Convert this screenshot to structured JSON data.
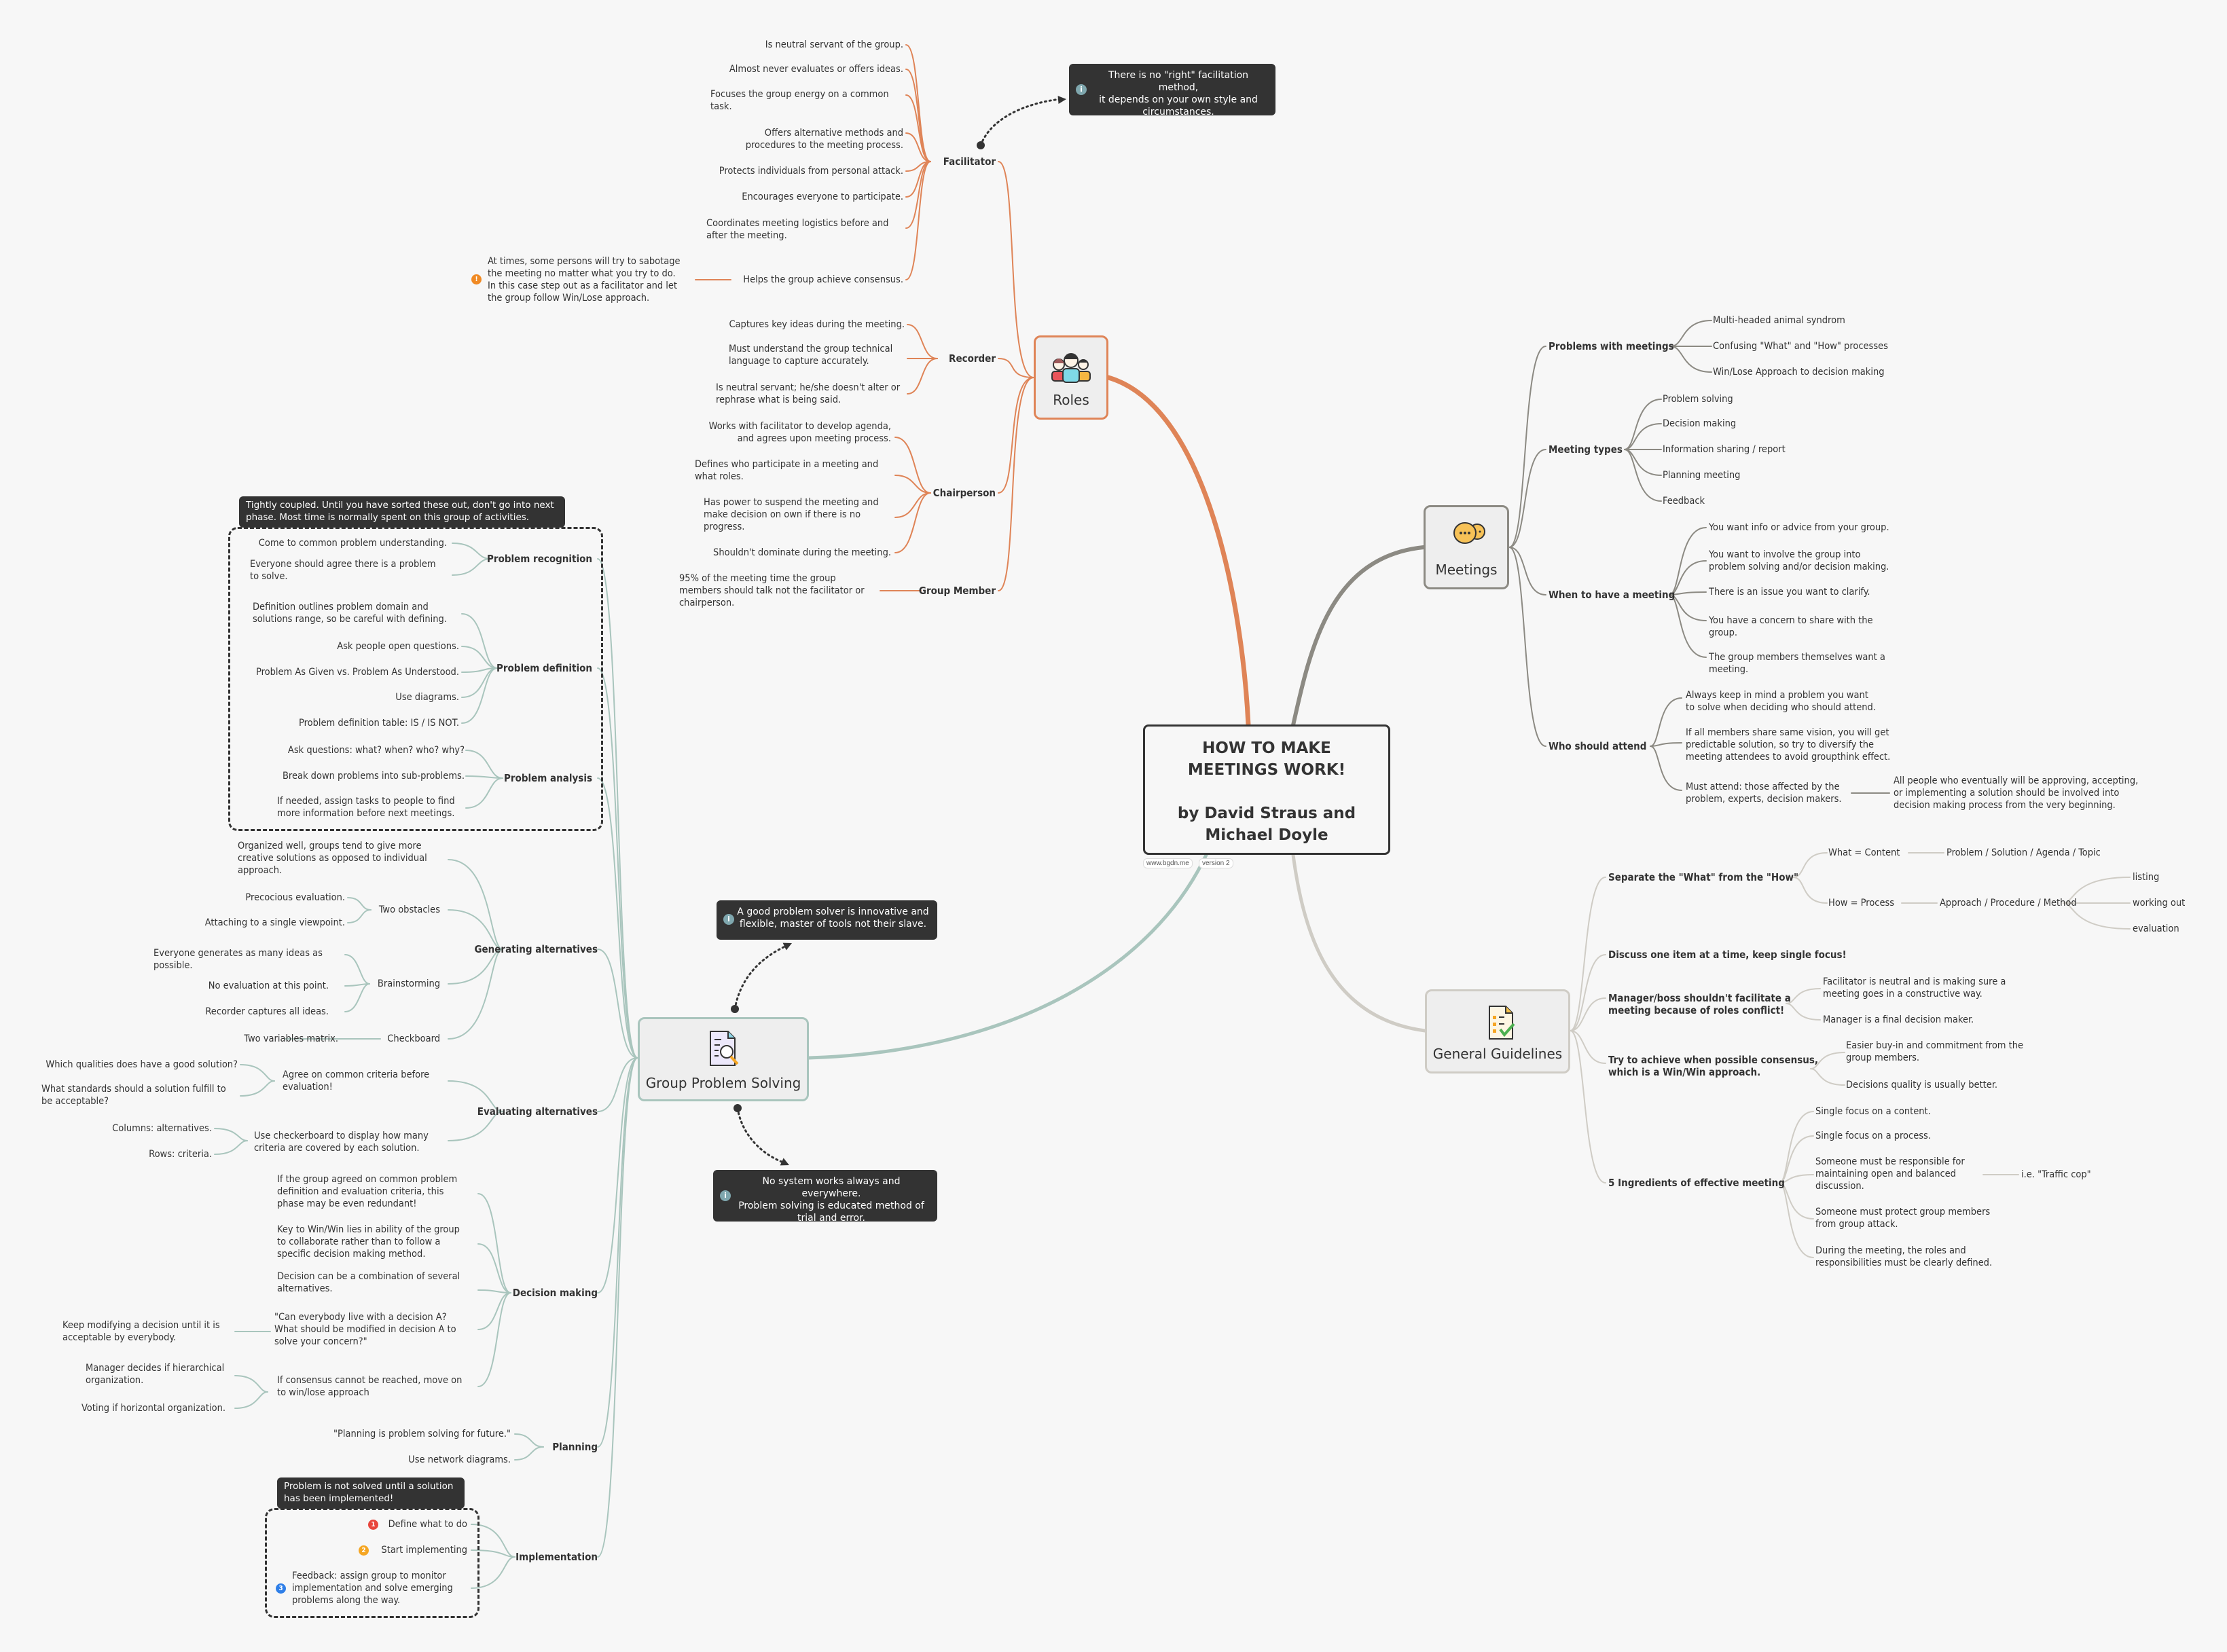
{
  "central": {
    "title_line1": "HOW TO MAKE",
    "title_line2": "MEETINGS WORK!",
    "author_line1": "by David Straus and",
    "author_line2": "Michael Doyle",
    "tags": [
      "www.bgdn.me",
      "version 2"
    ]
  },
  "colors": {
    "roles": "#df8457",
    "meetings": "#8c8a83",
    "guidelines": "#cfccc5",
    "problem_solving": "#a9c5bd",
    "note_bg": "#333333",
    "background": "#f7f7f7"
  },
  "roles": {
    "label": "Roles",
    "icon": "people-group-icon",
    "facilitator": {
      "label": "Facilitator",
      "items": [
        "Is neutral servant of the group.",
        "Almost never evaluates or offers ideas.",
        "Focuses the group energy on a common\ntask.",
        "Offers alternative methods and\nprocedures to the meeting process.",
        "Protects individuals from personal attack.",
        "Encourages everyone to participate.",
        "Coordinates meeting logistics before and\nafter the meeting.",
        "Helps the group achieve consensus."
      ],
      "consensus_warning": "At times, some persons will try to sabotage\nthe meeting no matter what you try to do.\nIn this case step out as a facilitator and let\nthe group follow Win/Lose approach.",
      "callout": "There is no \"right\" facilitation method,\nit depends on your own style and\ncircumstances."
    },
    "recorder": {
      "label": "Recorder",
      "items": [
        "Captures key ideas during the meeting.",
        "Must understand the group technical\nlanguage to capture accurately.",
        "Is neutral servant; he/she doesn't alter or\nrephrase what is being said."
      ]
    },
    "chairperson": {
      "label": "Chairperson",
      "items": [
        "Works with facilitator to develop agenda,\nand agrees upon meeting process.",
        "Defines who participate in a meeting and\nwhat roles.",
        "Has power to suspend the meeting and\nmake decision on own if there is no\nprogress.",
        "Shouldn't dominate during the meeting."
      ]
    },
    "group_member": {
      "label": "Group Member",
      "items": [
        "95% of the meeting time the group\nmembers should talk not the facilitator or\nchairperson."
      ]
    }
  },
  "meetings": {
    "label": "Meetings",
    "icon": "chat-bubbles-icon",
    "problems": {
      "label": "Problems with meetings",
      "items": [
        "Multi-headed animal syndrom",
        "Confusing \"What\" and \"How\" processes",
        "Win/Lose Approach to decision making"
      ]
    },
    "types": {
      "label": "Meeting types",
      "items": [
        "Problem solving",
        "Decision making",
        "Information sharing / report",
        "Planning meeting",
        "Feedback"
      ]
    },
    "when": {
      "label": "When to have a meeting",
      "items": [
        "You want info or advice from your group.",
        "You want to involve the group into\nproblem solving and/or decision making.",
        "There is an issue you want to clarify.",
        "You have a concern to share with the\ngroup.",
        "The group members themselves want a\nmeeting."
      ]
    },
    "who": {
      "label": "Who should attend",
      "items": [
        "Always keep in mind a problem you want\nto solve when deciding who should attend.",
        "If all members share same vision, you will get\npredictable solution, so try to diversify the\nmeeting attendees to avoid groupthink effect.",
        "Must attend: those affected by the\nproblem, experts, decision makers."
      ],
      "must_attend_detail": "All people who eventually will be approving, accepting,\nor implementing a solution should be involved into\ndecision making process from the very beginning."
    }
  },
  "guidelines": {
    "label": "General Guidelines",
    "icon": "checklist-icon",
    "separate": {
      "label": "Separate the \"What\" from the \"How\"",
      "what": "What = Content",
      "what_detail": "Problem / Solution / Agenda / Topic",
      "how": "How = Process",
      "how_detail": "Approach / Procedure / Method",
      "how_steps": [
        "listing",
        "working out",
        "evaluation"
      ]
    },
    "one_item": "Discuss one item at a time, keep single focus!",
    "manager": {
      "label": "Manager/boss shouldn't facilitate a\nmeeting because of roles conflict!",
      "items": [
        "Facilitator is neutral and is making sure a\nmeeting goes in a constructive way.",
        "Manager is a final decision maker."
      ]
    },
    "consensus": {
      "label": "Try to achieve when possible consensus,\nwhich is a Win/Win approach.",
      "items": [
        "Easier buy-in and commitment from the\ngroup members.",
        "Decisions quality is usually better."
      ]
    },
    "ingredients": {
      "label": "5 Ingredients of effective meeting",
      "items": [
        "Single focus on a content.",
        "Single focus on a process.",
        "Someone must be responsible for\nmaintaining open and balanced\ndiscussion.",
        "Someone must protect group members\nfrom group attack.",
        "During the meeting, the roles and\nresponsibilities must be clearly defined."
      ],
      "traffic_cop": "i.e. \"Traffic cop\""
    }
  },
  "problem_solving": {
    "label": "Group Problem Solving",
    "icon": "document-search-icon",
    "callout_top": "A good problem solver is innovative and\nflexible, master of tools not their slave.",
    "callout_bottom": "No system works always and everywhere.\nProblem solving is educated method of\ntrial and error.",
    "boundary_note": "Tightly coupled. Until you have sorted these out, don't go into next\nphase. Most time is normally spent on this group of activities.",
    "recognition": {
      "label": "Problem recognition",
      "items": [
        "Come to common problem understanding.",
        "Everyone should agree there is a problem\nto solve."
      ]
    },
    "definition": {
      "label": "Problem definition",
      "items": [
        "Definition outlines problem domain and\nsolutions range, so be careful with defining.",
        "Ask people open questions.",
        "Problem As Given vs. Problem As Understood.",
        "Use diagrams.",
        "Problem definition table: IS / IS NOT."
      ]
    },
    "analysis": {
      "label": "Problem analysis",
      "items": [
        "Ask questions: what? when? who? why?",
        "Break down problems into sub-problems.",
        "If needed, assign tasks to people to find\nmore information before next meetings."
      ]
    },
    "generating": {
      "label": "Generating alternatives",
      "intro": "Organized well, groups tend to give more\ncreative solutions as opposed to individual\napproach.",
      "obstacles": {
        "label": "Two obstacles",
        "items": [
          "Precocious evaluation.",
          "Attaching to a single viewpoint."
        ]
      },
      "brainstorming": {
        "label": "Brainstorming",
        "items": [
          "Everyone generates as many ideas as\npossible.",
          "No evaluation at this point.",
          "Recorder captures all ideas."
        ]
      },
      "checkboard": {
        "label": "Checkboard",
        "items": [
          "Two variables matrix."
        ]
      }
    },
    "evaluating": {
      "label": "Evaluating alternatives",
      "criteria": {
        "label": "Agree on common criteria before\nevaluation!",
        "items": [
          "Which qualities does have a good solution?",
          "What standards should a solution fulfill to\nbe acceptable?"
        ]
      },
      "checkerboard": {
        "label": "Use checkerboard to display how many\ncriteria are covered by each solution.",
        "items": [
          "Columns: alternatives.",
          "Rows: criteria."
        ]
      }
    },
    "decision": {
      "label": "Decision making",
      "items": [
        "If the group agreed on common problem\ndefinition and evaluation criteria, this\nphase may be even redundant!",
        "Key to Win/Win lies in ability of the group\nto collaborate rather than to follow a\nspecific decision making method.",
        "Decision can be a combination of several\nalternatives.",
        "\"Can everybody live with a decision A?\nWhat should be modified in decision A to\nsolve your concern?\"",
        "If consensus cannot be reached, move on\nto win/lose approach"
      ],
      "modify_detail": "Keep modifying a decision until it is\nacceptable by everybody.",
      "fallback_items": [
        "Manager decides if hierarchical\norganization.",
        "Voting if horizontal organization."
      ]
    },
    "planning": {
      "label": "Planning",
      "items": [
        "\"Planning is problem solving for future.\"",
        "Use network diagrams."
      ]
    },
    "implementation": {
      "label": "Implementation",
      "note": "Problem is not solved until a solution\nhas been implemented!",
      "items": [
        {
          "priority": "1",
          "color": "#e8453c",
          "text": "Define what to do"
        },
        {
          "priority": "2",
          "color": "#f5a623",
          "text": "Start implementing"
        },
        {
          "priority": "3",
          "color": "#2f7fe8",
          "text": "Feedback: assign group to monitor\nimplementation and solve emerging\nproblems along the way."
        }
      ]
    }
  }
}
